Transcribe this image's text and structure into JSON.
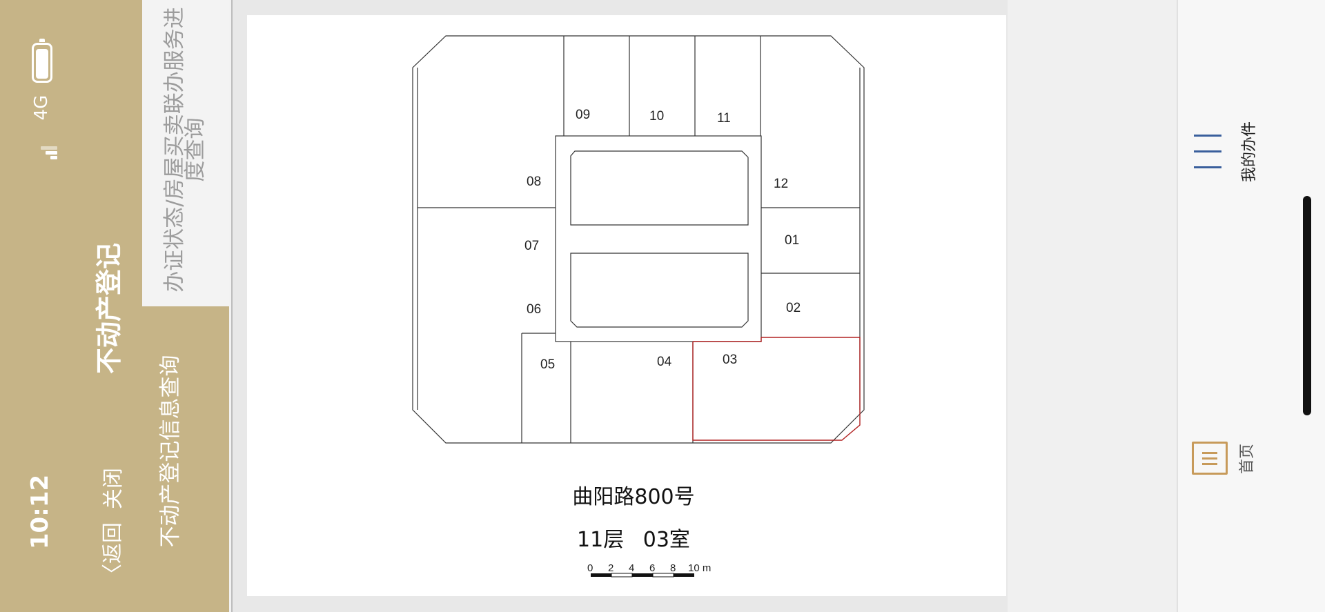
{
  "status_bar": {
    "time": "10:12",
    "network": "4G"
  },
  "header": {
    "title": "不动产登记",
    "back_label": "〈返回",
    "close_label": "关闭"
  },
  "side_menu": {
    "items": [
      {
        "label": "办证状态/房屋买卖联办服务进度查询",
        "active": false
      },
      {
        "label": "不动产登记信息查询",
        "active": true
      }
    ]
  },
  "floor_plan": {
    "address": "曲阳路800号",
    "floor_room": "11层 03室",
    "highlighted_room": "03",
    "rooms": [
      "01",
      "02",
      "03",
      "04",
      "05",
      "06",
      "07",
      "08",
      "09",
      "10",
      "11",
      "12"
    ],
    "scale_labels": [
      "0",
      "2",
      "4",
      "6",
      "8",
      "10 m"
    ]
  },
  "tab_bar": {
    "items": [
      {
        "label": "我的办件",
        "icon": "menu-lines-icon"
      },
      {
        "label": "首页",
        "icon": "home-icon"
      }
    ]
  },
  "colors": {
    "header_bg": "#c6b487",
    "highlight": "#b22222",
    "active_tab": "#c79a5a",
    "tab_icon": "#3a5f9c"
  }
}
